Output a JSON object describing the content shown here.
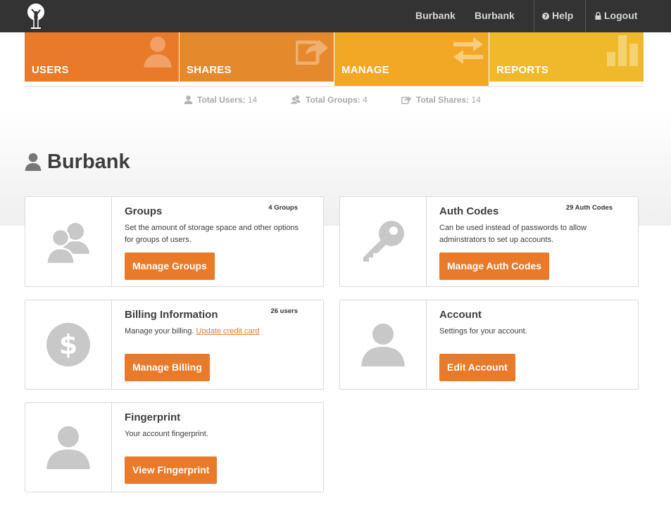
{
  "topbar": {
    "links": [
      "Burbank",
      "Burbank"
    ],
    "help_label": "Help",
    "logout_label": "Logout"
  },
  "tiles": [
    {
      "label": "USERS",
      "icon": "user-icon",
      "color": "#e87a2a"
    },
    {
      "label": "SHARES",
      "icon": "share-icon",
      "color": "#e58a2c"
    },
    {
      "label": "MANAGE",
      "icon": "arrows-exchange-icon",
      "color": "#f3a825"
    },
    {
      "label": "REPORTS",
      "icon": "bar-chart-icon",
      "color": "#f0b92c"
    }
  ],
  "stats": {
    "users_label": "Total Users:",
    "users_value": "14",
    "groups_label": "Total Groups:",
    "groups_value": "4",
    "shares_label": "Total Shares:",
    "shares_value": "14"
  },
  "page": {
    "title": "Burbank"
  },
  "cards": {
    "groups": {
      "title": "Groups",
      "count": "4 Groups",
      "description": "Set the amount of storage space and other options for groups of users.",
      "button": "Manage Groups"
    },
    "auth": {
      "title": "Auth Codes",
      "count": "29 Auth Codes",
      "description": "Can be used instead of passwords to allow adminstrators to set up accounts.",
      "button": "Manage Auth Codes"
    },
    "billing": {
      "title": "Billing Information",
      "count": "26 users",
      "description": "Manage your billing.",
      "link": "Update credit card",
      "button": "Manage Billing"
    },
    "account": {
      "title": "Account",
      "description": "Settings for your account.",
      "button": "Edit Account"
    },
    "fingerprint": {
      "title": "Fingerprint",
      "description": "Your account fingerprint.",
      "button": "View Fingerprint"
    }
  },
  "colors": {
    "accent": "#e87a2a",
    "topbar": "#333333",
    "icon_gray": "#c8c8c8"
  }
}
